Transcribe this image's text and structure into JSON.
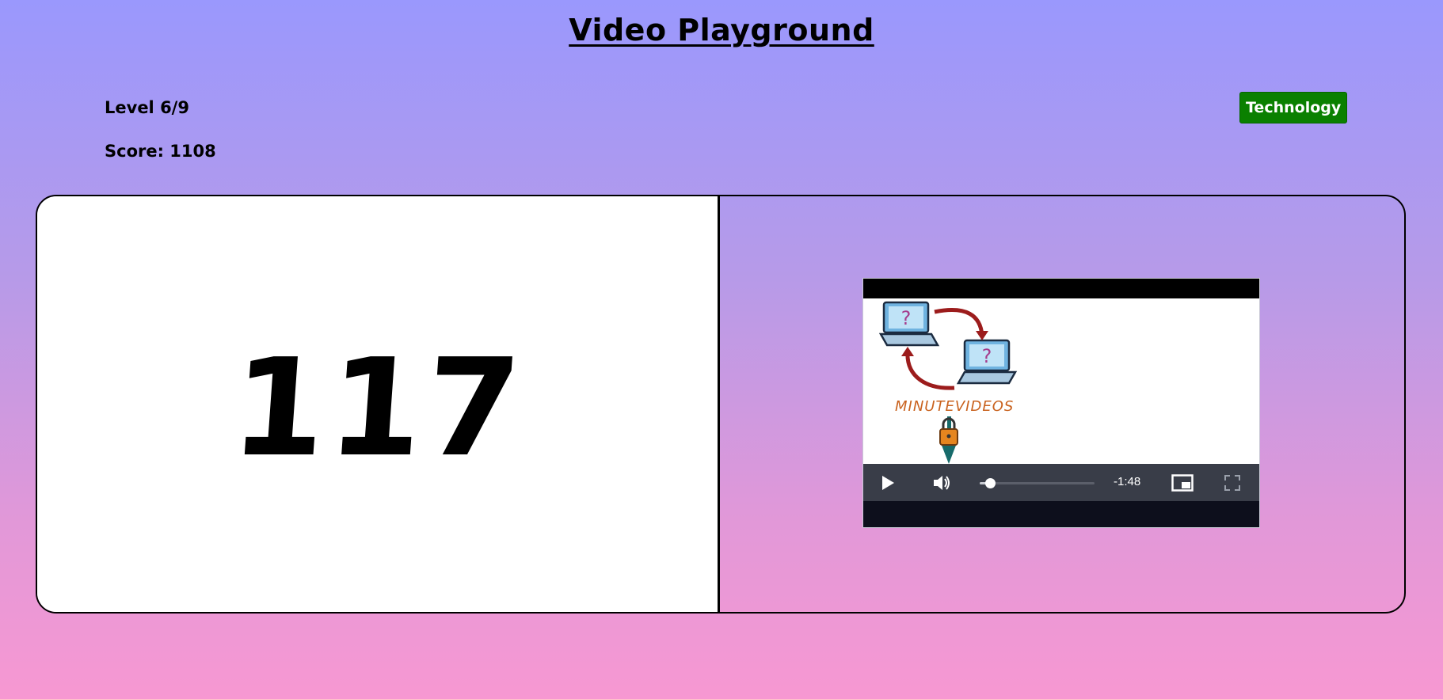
{
  "page": {
    "title": "Video Playground"
  },
  "stats": {
    "level": "Level 6/9",
    "score": "Score: 1108"
  },
  "category": {
    "label": "Technology",
    "color": "#0a8000"
  },
  "left_panel": {
    "number": "117"
  },
  "video": {
    "thumbnail_text": "MINUTEVIDEOS",
    "time_remaining": "-1:48",
    "progress": 0.09,
    "icons": {
      "play": "play-icon",
      "volume": "volume-icon",
      "pip": "picture-in-picture-icon",
      "fullscreen": "fullscreen-icon"
    }
  }
}
